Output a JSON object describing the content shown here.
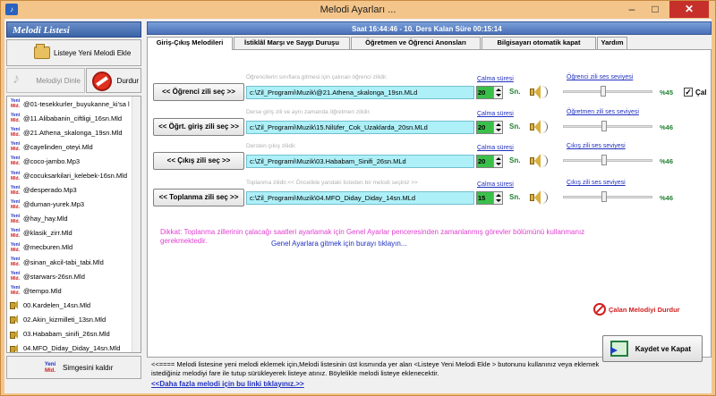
{
  "window": {
    "title": "Melodi  Ayarları ...",
    "icon": "app-icon",
    "minimize": "‒",
    "maximize": "□",
    "close": "✕"
  },
  "left": {
    "header": "Melodi Listesi",
    "add_button": "Listeye Yeni Melodi Ekle",
    "listen_button": "Melodiyi Dinle",
    "stop_button": "Durdur",
    "remove_button": "Simgesini kaldır",
    "badge_top": "Yeni",
    "badge_bottom": "Mld.",
    "items": [
      {
        "name": "@01-tesekkurler_buyukanne_ki'sa l",
        "icon": "mld"
      },
      {
        "name": "@11.Alibabanin_ciftligi_16sn.Mld",
        "icon": "mld"
      },
      {
        "name": "@21.Athena_skalonga_19sn.Mld",
        "icon": "mld"
      },
      {
        "name": "@cayelinden_oteyi.Mld",
        "icon": "mld"
      },
      {
        "name": "@coco-jambo.Mp3",
        "icon": "mld"
      },
      {
        "name": "@cocuksarkilari_kelebek-16sn.Mld",
        "icon": "mld"
      },
      {
        "name": "@desperado.Mp3",
        "icon": "mld"
      },
      {
        "name": "@duman-yurek.Mp3",
        "icon": "mld"
      },
      {
        "name": "@hay_hay.Mld",
        "icon": "mld"
      },
      {
        "name": "@klasik_zirr.Mld",
        "icon": "mld"
      },
      {
        "name": "@mecburen.Mld",
        "icon": "mld"
      },
      {
        "name": "@sinan_akcil-tabi_tabi.Mld",
        "icon": "mld"
      },
      {
        "name": "@starwars-26sn.Mld",
        "icon": "mld"
      },
      {
        "name": "@tempo.Mld",
        "icon": "mld"
      },
      {
        "name": "00.Kardelen_14sn.Mld",
        "icon": "speaker"
      },
      {
        "name": "02.Akin_kizmilleti_13sn.Mld",
        "icon": "speaker"
      },
      {
        "name": "03.Hababam_sinifi_26sn.Mld",
        "icon": "speaker"
      },
      {
        "name": "04.MFO_Diday_Diday_14sn.Mld",
        "icon": "speaker"
      }
    ]
  },
  "status": {
    "text": "Saat  16:44:46  -  10. Ders Kalan Süre 00:15:14"
  },
  "tabs": [
    {
      "label": "Giriş-Çıkış Melodileri",
      "active": true
    },
    {
      "label": "İstiklâl Marşı ve Saygı Duruşu",
      "active": false
    },
    {
      "label": "Öğretmen ve Öğrenci Anonsları",
      "active": false
    },
    {
      "label": "Bilgisayarı otomatik kapat",
      "active": false
    },
    {
      "label": "Yardım",
      "active": false
    }
  ],
  "rows": [
    {
      "button": "<< Öğrenci zili seç >>",
      "hint": "Öğrencilerin sınıflara gitmesi için çalınan  öğrenci  zilidir.",
      "path": "c:\\Zil_Programi\\Muzik\\@21.Athena_skalonga_19sn.MLd",
      "duration_label": "Çalma süresi",
      "duration": "20",
      "unit": "Sn.",
      "volume_label": "Öğrenci zili ses seviyesi",
      "volume": "%45",
      "volume_value": 0.45
    },
    {
      "button": "<< Öğrt. giriş zili seç >>",
      "hint": "Derse giriş zili ve aynı zamanda öğretmen zilidir.",
      "path": "c:\\Zil_Programi\\Muzik\\15.Nilüfer_Cok_Uzaklarda_20sn.MLd",
      "duration_label": "Çalma süresi",
      "duration": "20",
      "unit": "Sn.",
      "volume_label": "Öğretmen zili ses seviyesi",
      "volume": "%46",
      "volume_value": 0.46
    },
    {
      "button": "<< Çıkış zili seç >>",
      "hint": "Dersten çıkış zilidir.",
      "path": "c:\\Zil_Programi\\Muzik\\03.Hababam_Sinifi_26sn.MLd",
      "duration_label": "Çalma süresi",
      "duration": "20",
      "unit": "Sn.",
      "volume_label": "Çıkış zili ses seviyesi",
      "volume": "%46",
      "volume_value": 0.46
    },
    {
      "button": "<< Toplanma zili seç >>",
      "hint": "Toplanma zilidir.<< Öncelikle yandaki listeden bir melodi seçiniz >>",
      "path": "c:\\Zil_Programi\\Muzik\\04.MFO_Diday_Diday_14sn.MLd",
      "duration_label": "Çalma süresi",
      "duration": "15",
      "unit": "Sn.",
      "volume_label": "Çıkış zili ses seviyesi",
      "volume": "%46",
      "volume_value": 0.46
    }
  ],
  "checkbox": {
    "label": "Çal",
    "checked": "✓"
  },
  "warning": "Dikkat: Toplanma zillerinin çalacağı saatleri  ayarlamak için Genel Ayarlar penceresinden zamanlanmış görevler bölümünü kullanmanız gerekmektedir.",
  "general_link": "Genel Ayarlara gitmek için burayı tıklayın...",
  "stop_playing": "Çalan Melodiyi Durdur",
  "save_button": "Kaydet ve Kapat",
  "info_line1": "<<====    Melodi listesine yeni melodi eklemek için,Melodi listesinin üst kısmında yer alan   <Listeye Yeni Melodi Ekle > butonunu kullanınız veya eklemek",
  "info_line2": "istediğiniz melodiyi  fare ile tutup sürükleyerek listeye  atınız.  Böylelikle melodi listeye eklenecektir.",
  "more_link": "<<Daha fazla melodi için bu linki tıklayınız.>>",
  "colors": {
    "title_bar": "#f4c58a",
    "status_bar": "#4a70b8",
    "path_bg": "#aef0f8",
    "duration_bg": "#3ac04a",
    "warning": "#e040d0"
  }
}
